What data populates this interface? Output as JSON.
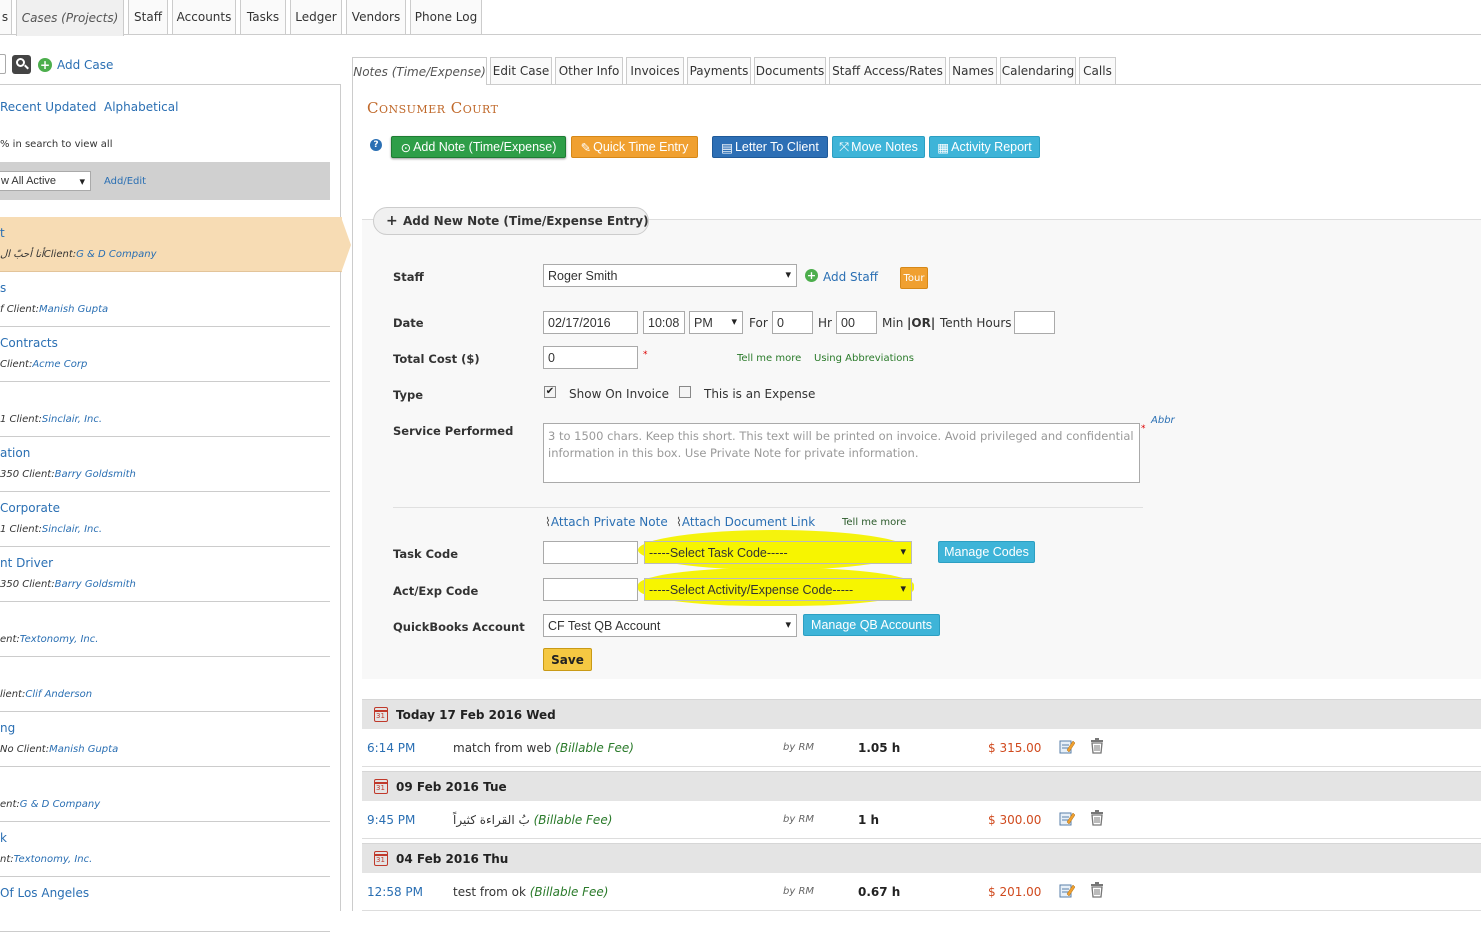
{
  "top_tabs": [
    {
      "label": "s"
    },
    {
      "label": "Cases (Projects)"
    },
    {
      "label": "Staff"
    },
    {
      "label": "Accounts"
    },
    {
      "label": "Tasks"
    },
    {
      "label": "Ledger"
    },
    {
      "label": "Vendors"
    },
    {
      "label": "Phone Log"
    }
  ],
  "left": {
    "add_case": "Add Case",
    "recent_updated": "Recent Updated",
    "alphabetical": "Alphabetical",
    "search_hint": "% in search to view all",
    "filter_value": "w All Active",
    "add_edit": "Add/Edit",
    "client_prefix": "Client:",
    "cases": [
      {
        "name": "t",
        "pre": "أنا أحبّ ال",
        "client": "G & D Company"
      },
      {
        "name": "s",
        "pre": "f ",
        "client": "Manish Gupta"
      },
      {
        "name": "Contracts",
        "pre": "",
        "client": "Acme Corp"
      },
      {
        "name": "",
        "pre": "1 ",
        "client": "Sinclair, Inc."
      },
      {
        "name": "ation",
        "pre": "350 ",
        "client": "Barry Goldsmith"
      },
      {
        "name": " Corporate",
        "pre": "1 ",
        "client": "Sinclair, Inc."
      },
      {
        "name": "nt Driver",
        "pre": "350 ",
        "client": "Barry Goldsmith"
      },
      {
        "name": "",
        "pre": "ent:",
        "client": "Textonomy, Inc."
      },
      {
        "name": "",
        "pre": "lient:",
        "client": "Clif Anderson"
      },
      {
        "name": "ng",
        "pre": "No ",
        "client": "Manish Gupta"
      },
      {
        "name": "",
        "pre": "ent:",
        "client": "G & D Company"
      },
      {
        "name": "k",
        "pre": "nt:",
        "client": "Textonomy, Inc."
      },
      {
        "name": " Of Los Angeles",
        "pre": "",
        "client": ""
      }
    ]
  },
  "right_tabs": [
    {
      "label": "Notes (Time/Expense)"
    },
    {
      "label": "Edit Case"
    },
    {
      "label": "Other Info"
    },
    {
      "label": "Invoices"
    },
    {
      "label": "Payments"
    },
    {
      "label": "Documents"
    },
    {
      "label": "Staff Access/Rates"
    },
    {
      "label": "Names"
    },
    {
      "label": "Calendaring"
    },
    {
      "label": "Calls"
    }
  ],
  "case_title": "Consumer Court",
  "actions": {
    "add_note": "Add Note (Time/Expense)",
    "quick_time": "Quick Time Entry",
    "letter": "Letter To Client",
    "move_notes": "Move Notes",
    "activity_report": "Activity Report"
  },
  "form": {
    "section_title": "Add New Note (Time/Expense Entry)",
    "staff_label": "Staff",
    "staff_value": "Roger Smith",
    "add_staff": "Add Staff",
    "tour": "Tour",
    "date_label": "Date",
    "date_value": "02/17/2016",
    "time_value": "10:08",
    "ampm": "PM",
    "for_label": "For",
    "hours_value": "0",
    "hr_label": "Hr",
    "min_value": "00",
    "min_label": "Min",
    "or_label": "|OR|",
    "tenth_label": "Tenth Hours",
    "total_cost_label": "Total Cost ($)",
    "total_cost_value": "0",
    "tell_me_more": "Tell me more",
    "using_abbr": "Using Abbreviations",
    "type_label": "Type",
    "show_on_invoice": "Show On Invoice",
    "is_expense": "This is an Expense",
    "service_label": "Service Performed",
    "service_placeholder": "3 to 1500 chars. Keep this short.  This text will be printed on invoice. Avoid privileged and confidential information in this box. Use Private Note for private information.",
    "abbr": "Abbr",
    "attach_private": "Attach Private Note",
    "attach_doc": "Attach Document Link",
    "tell_me_more2": "Tell me more",
    "task_code_label": "Task Code",
    "task_code_select": "-----Select Task Code-----",
    "manage_codes": "Manage Codes",
    "act_code_label": "Act/Exp Code",
    "act_code_select": "-----Select Activity/Expense Code-----",
    "qb_label": "QuickBooks Account",
    "qb_value": "CF Test QB Account",
    "manage_qb": "Manage QB Accounts",
    "save": "Save"
  },
  "days": [
    {
      "header": "Today 17 Feb 2016 Wed",
      "entries": [
        {
          "time": "6:14 PM",
          "desc": "match from web",
          "fee": "(Billable Fee)",
          "by": "by RM",
          "hours": "1.05 h",
          "amount": "$ 315.00"
        }
      ]
    },
    {
      "header": "09 Feb 2016 Tue",
      "entries": [
        {
          "time": "9:45 PM",
          "desc": "بُ القراءة كثيراً",
          "fee": "(Billable Fee)",
          "by": "by RM",
          "hours": "1 h",
          "amount": "$ 300.00"
        }
      ]
    },
    {
      "header": "04 Feb 2016 Thu",
      "entries": [
        {
          "time": "12:58 PM",
          "desc": "test from ok",
          "fee": "(Billable Fee)",
          "by": "by RM",
          "hours": "0.67 h",
          "amount": "$ 201.00"
        }
      ]
    }
  ]
}
